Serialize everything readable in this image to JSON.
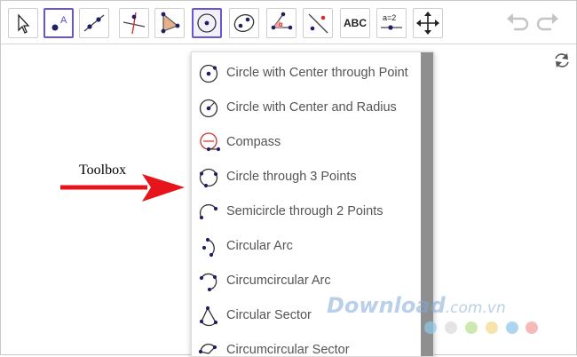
{
  "toolbar": {
    "tools": [
      {
        "name": "move-tool",
        "icon": "arrow-pointer-icon"
      },
      {
        "name": "point-tool",
        "icon": "point-a-icon",
        "text": "A"
      },
      {
        "name": "line-tool",
        "icon": "line-through-points-icon"
      },
      {
        "name": "perpendicular-line-tool",
        "icon": "perpendicular-line-icon"
      },
      {
        "name": "polygon-tool",
        "icon": "polygon-icon"
      },
      {
        "name": "circle-center-point-tool",
        "icon": "circle-center-point-icon"
      },
      {
        "name": "ellipse-tool",
        "icon": "ellipse-icon"
      },
      {
        "name": "angle-tool",
        "icon": "angle-icon",
        "text": "α"
      },
      {
        "name": "reflect-tool",
        "icon": "reflect-about-line-icon"
      },
      {
        "name": "text-tool",
        "icon": "text-icon",
        "text": "ABC"
      },
      {
        "name": "slider-tool",
        "icon": "slider-icon",
        "text": "a=2"
      },
      {
        "name": "move-graphics-view-tool",
        "icon": "move-arrows-icon"
      }
    ],
    "undo_icon": "undo-icon",
    "redo_icon": "redo-icon"
  },
  "graphics": {
    "refresh_icon": "refresh-icon"
  },
  "dropdown": {
    "items": [
      {
        "label": "Circle with Center through Point",
        "icon": "circle-center-point-icon"
      },
      {
        "label": "Circle with Center and Radius",
        "icon": "circle-center-radius-icon"
      },
      {
        "label": "Compass",
        "icon": "compass-icon"
      },
      {
        "label": "Circle through 3 Points",
        "icon": "circle-three-points-icon"
      },
      {
        "label": "Semicircle through 2 Points",
        "icon": "semicircle-icon"
      },
      {
        "label": "Circular Arc",
        "icon": "circular-arc-icon"
      },
      {
        "label": "Circumcircular Arc",
        "icon": "circumcircular-arc-icon"
      },
      {
        "label": "Circular Sector",
        "icon": "circular-sector-icon"
      },
      {
        "label": "Circumcircular Sector",
        "icon": "circumcircular-sector-icon"
      }
    ]
  },
  "annotation": {
    "label": "Toolbox",
    "arrow_color": "#e8141b"
  },
  "watermark": {
    "brand": "Download",
    "suffix": ".com.vn",
    "dot_colors": [
      "#8fc9ea",
      "#d9d9d9",
      "#b9e08e",
      "#f4d98a",
      "#8cc3ea",
      "#f29c9c"
    ]
  },
  "colors": {
    "accent": "#6557d2",
    "point": "#1f1f66",
    "compass_red": "#d0312d"
  }
}
